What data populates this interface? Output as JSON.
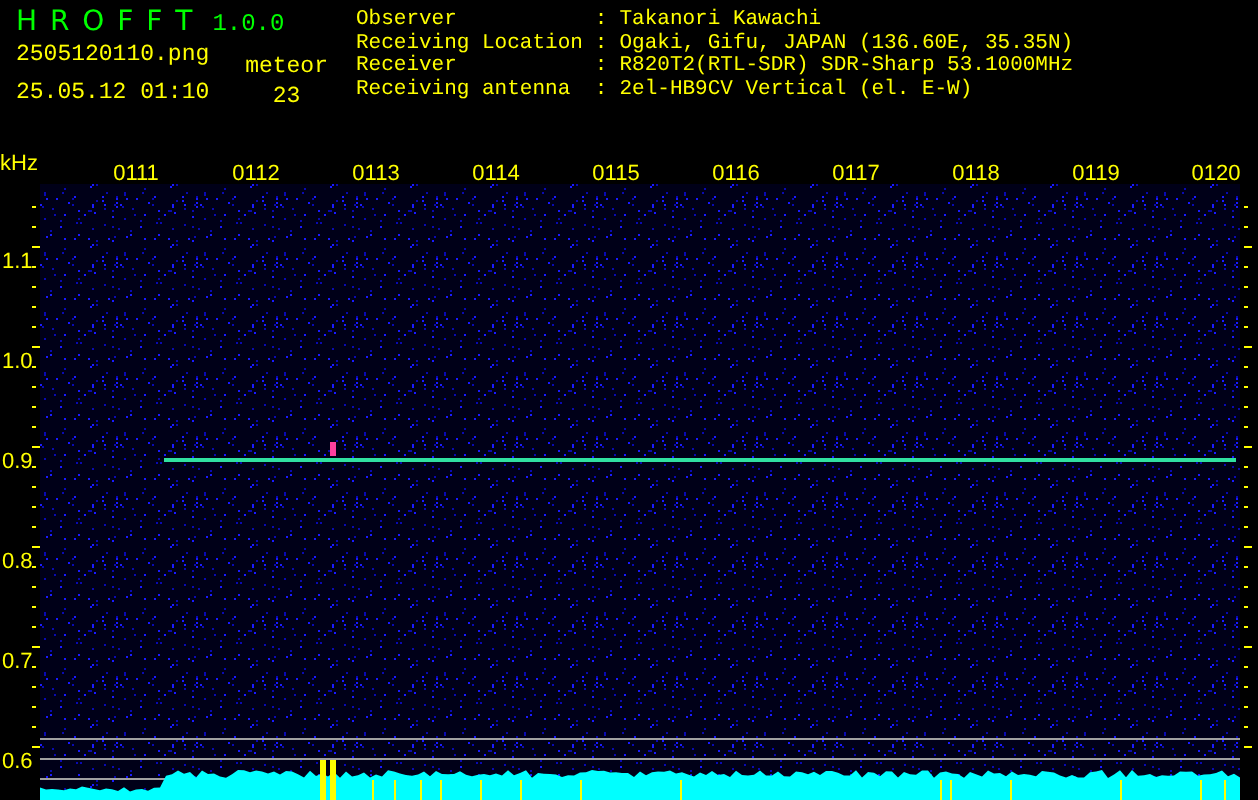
{
  "app": {
    "name": "H R O F F T",
    "version": "1.0.0"
  },
  "file": "2505120110.png",
  "datetime": "25.05.12 01:10",
  "meteor": {
    "label": "meteor",
    "count": "23"
  },
  "info": [
    {
      "label": "Observer",
      "separator": ":",
      "value": "Takanori Kawachi"
    },
    {
      "label": "Receiving Location",
      "separator": ":",
      "value": "Ogaki, Gifu, JAPAN (136.60E, 35.35N)"
    },
    {
      "label": "Receiver",
      "separator": ":",
      "value": "R820T2(RTL-SDR) SDR-Sharp 53.1000MHz"
    },
    {
      "label": "Receiving antenna",
      "separator": ":",
      "value": "2el-HB9CV Vertical (el. E-W)"
    }
  ],
  "spectrogram": {
    "unit": "kHz",
    "time_labels": [
      "0111",
      "0112",
      "0113",
      "0114",
      "0115",
      "0116",
      "0117",
      "0118",
      "0119",
      "0120"
    ],
    "freq_labels": [
      "1.1",
      "1.0",
      "0.9",
      "0.8",
      "0.7",
      "0.6"
    ]
  }
}
